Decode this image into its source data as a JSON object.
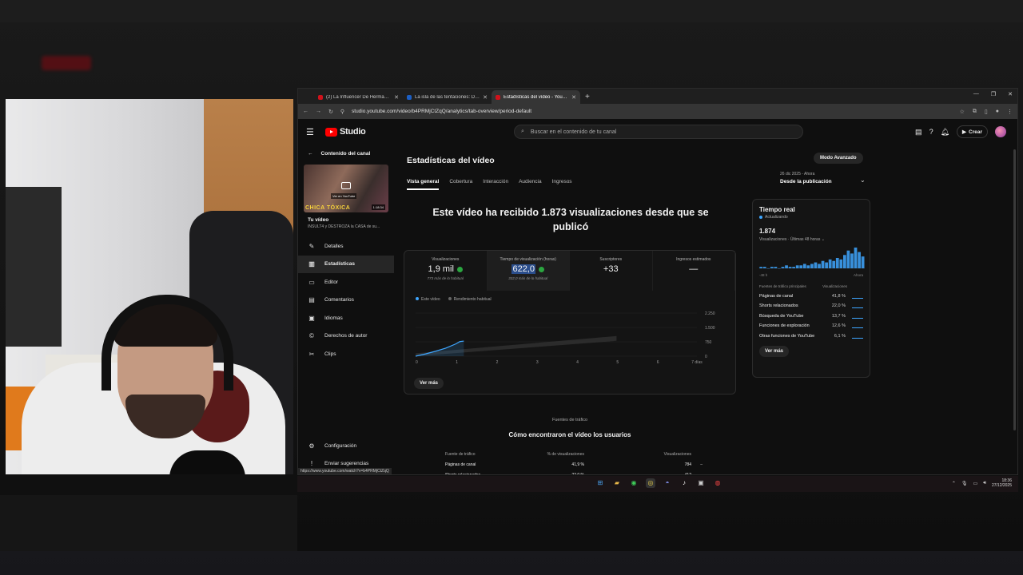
{
  "browser": {
    "tabs": [
      {
        "label": "(2) La Influencer De Hermano M...",
        "active": false
      },
      {
        "label": "La isla de las tentaciones: Deb...",
        "active": false
      },
      {
        "label": "Estadísticas del vídeo - YouTub...",
        "active": true
      }
    ],
    "url": "studio.youtube.com/video/b4PRMjCtZqQ/analytics/tab-overview/period-default",
    "status_url": "https://www.youtube.com/watch?v=b4PRMjCtZqQ"
  },
  "header": {
    "logo": "Studio",
    "search_placeholder": "Buscar en el contenido de tu canal",
    "create_label": "Crear"
  },
  "sidebar": {
    "back_label": "Contenido del canal",
    "thumb_caption": "CHICA TÓXICA",
    "thumb_link": "Ver en YouTube",
    "thumb_duration": "1:18:34",
    "your_video": "Tu vídeo",
    "video_title": "INSULT4 y DESTROZA la CASA de su...",
    "items": [
      {
        "label": "Detalles",
        "icon": "pencil-icon",
        "glyph": "✎"
      },
      {
        "label": "Estadísticas",
        "icon": "bar-chart-icon",
        "glyph": "▥"
      },
      {
        "label": "Editor",
        "icon": "film-icon",
        "glyph": "▭"
      },
      {
        "label": "Comentarios",
        "icon": "comment-icon",
        "glyph": "▤"
      },
      {
        "label": "Idiomas",
        "icon": "subtitles-icon",
        "glyph": "▣"
      },
      {
        "label": "Derechos de autor",
        "icon": "copyright-icon",
        "glyph": "©"
      },
      {
        "label": "Clips",
        "icon": "scissors-icon",
        "glyph": "✂"
      }
    ],
    "bottom": [
      {
        "label": "Configuración",
        "icon": "gear-icon",
        "glyph": "⚙"
      },
      {
        "label": "Enviar sugerencias",
        "icon": "feedback-icon",
        "glyph": "!"
      }
    ]
  },
  "main": {
    "title": "Estadísticas del vídeo",
    "advanced": "Modo Avanzado",
    "tabs": [
      "Vista general",
      "Cobertura",
      "Interacción",
      "Audiencia",
      "Ingresos"
    ],
    "period_range": "26 dic 2025 - Ahora",
    "period_label": "Desde la publicación",
    "headline": "Este vídeo ha recibido 1.873 visualizaciones desde que se publicó",
    "metrics": [
      {
        "label": "Visualizaciones",
        "value": "1,9 mil",
        "sub": "773 más de lo habitual"
      },
      {
        "label": "Tiempo de visualización (horas)",
        "value": "622,0",
        "sub": "332,0 más de lo habitual"
      },
      {
        "label": "Suscriptores",
        "value": "+33",
        "sub": ""
      },
      {
        "label": "Ingresos estimados",
        "value": "—",
        "sub": ""
      }
    ],
    "legend": [
      "Este vídeo",
      "Rendimiento habitual"
    ],
    "see_more": "Ver más"
  },
  "chart_data": {
    "type": "line",
    "x": [
      0,
      0.25,
      0.5,
      0.75,
      1.0,
      1.1,
      1.2
    ],
    "series": [
      {
        "name": "Este vídeo",
        "values": [
          0,
          120,
          260,
          420,
          640,
          760,
          790
        ]
      }
    ],
    "band_range": [
      0,
      5
    ],
    "x_ticks": [
      "0",
      "1",
      "2",
      "3",
      "4",
      "5",
      "6",
      "7 días"
    ],
    "y_ticks": [
      "2.250",
      "1.500",
      "750",
      "0"
    ],
    "ylim": [
      0,
      2250
    ],
    "accent": "#3ea6ff"
  },
  "realtime": {
    "title": "Tiempo real",
    "updating": "Actualizando",
    "value": "1.874",
    "subtitle": "Visualizaciones · Últimas 48 horas",
    "axis_left": "-48 h",
    "axis_right": "Ahora",
    "bars": [
      1,
      1,
      0,
      1,
      1,
      0,
      1,
      2,
      1,
      1,
      2,
      2,
      3,
      2,
      3,
      4,
      3,
      5,
      4,
      6,
      5,
      7,
      6,
      9,
      12,
      10,
      14,
      11,
      8
    ],
    "col1": "Fuentes de tráfico principales",
    "col2": "Visualizaciones",
    "rows": [
      {
        "name": "Páginas de canal",
        "pct": "41,8 %"
      },
      {
        "name": "Shorts relacionados",
        "pct": "22,0 %"
      },
      {
        "name": "Búsqueda de YouTube",
        "pct": "13,7 %"
      },
      {
        "name": "Funciones de exploración",
        "pct": "12,6 %"
      },
      {
        "name": "Otras funciones de YouTube",
        "pct": "6,1 %"
      }
    ],
    "see_more": "Ver más"
  },
  "traffic": {
    "label": "Fuentes de tráfico",
    "title": "Cómo encontraron el vídeo los usuarios",
    "headers": [
      "Fuente de tráfico",
      "% de visualizaciones",
      "Visualizaciones"
    ],
    "rows": [
      {
        "source": "Páginas de canal",
        "pct": "41,9 %",
        "views": "784",
        "mark": "–"
      },
      {
        "source": "Shorts relacionados",
        "pct": "22,0 %",
        "views": "412",
        "mark": "–"
      }
    ]
  },
  "taskbar": {
    "time": "18:36",
    "date": "27/12/2025"
  }
}
